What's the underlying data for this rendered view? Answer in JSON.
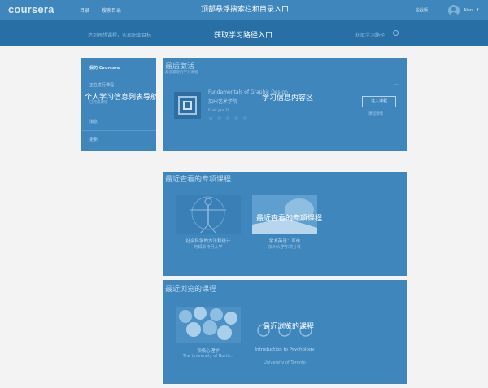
{
  "header": {
    "logo": "coursera",
    "nav": [
      "目录",
      "搜索目录"
    ],
    "overlay_label": "顶部悬浮搜索栏和目录入口",
    "enterprise": "企业版",
    "username": "Alan",
    "chevron": "▾"
  },
  "path_bar": {
    "left_text": "达到理想课程，实现职业目标",
    "overlay_label": "获取学习路径入口",
    "right_text": "获取学习路径"
  },
  "sidebar": {
    "overlay_label": "个人学习信息列表导航",
    "items": [
      "我的 Coursera",
      "正在进行课程",
      "已完成课程",
      "消息",
      "更新"
    ]
  },
  "recent_active": {
    "overlay_label": "学习信息内容区",
    "title": "最后激活",
    "subtitle": "最近最近的学习课程",
    "course": {
      "name_en": "Fundamentals of Graphic Design",
      "university": "加州艺术学院",
      "meta": "Ends Jan 10",
      "stars": "☆ ☆ ☆ ☆ ☆",
      "button": "进入课程",
      "details": "课程详情",
      "more": "···"
    }
  },
  "specializations": {
    "title": "最近查看的专项课程",
    "overlay_label": "最近查看的专项课程",
    "cards": [
      {
        "title": "社会科学的方法和统计",
        "org": "阿姆斯特丹大学"
      },
      {
        "title": "学术英语：写作",
        "org": "加州大学尔湾分校"
      }
    ]
  },
  "browsed": {
    "title": "最近浏览的课程",
    "overlay_label": "最近浏览的课程",
    "cards": [
      {
        "title": "积极心理学",
        "org": "The University of North..."
      },
      {
        "title": "Introduction to Psychology",
        "org": "University of Toronto"
      }
    ]
  },
  "colors": {
    "overlay": "#3f86bd",
    "path_bar": "#286fa6",
    "page_bg": "#f3f3f3"
  }
}
